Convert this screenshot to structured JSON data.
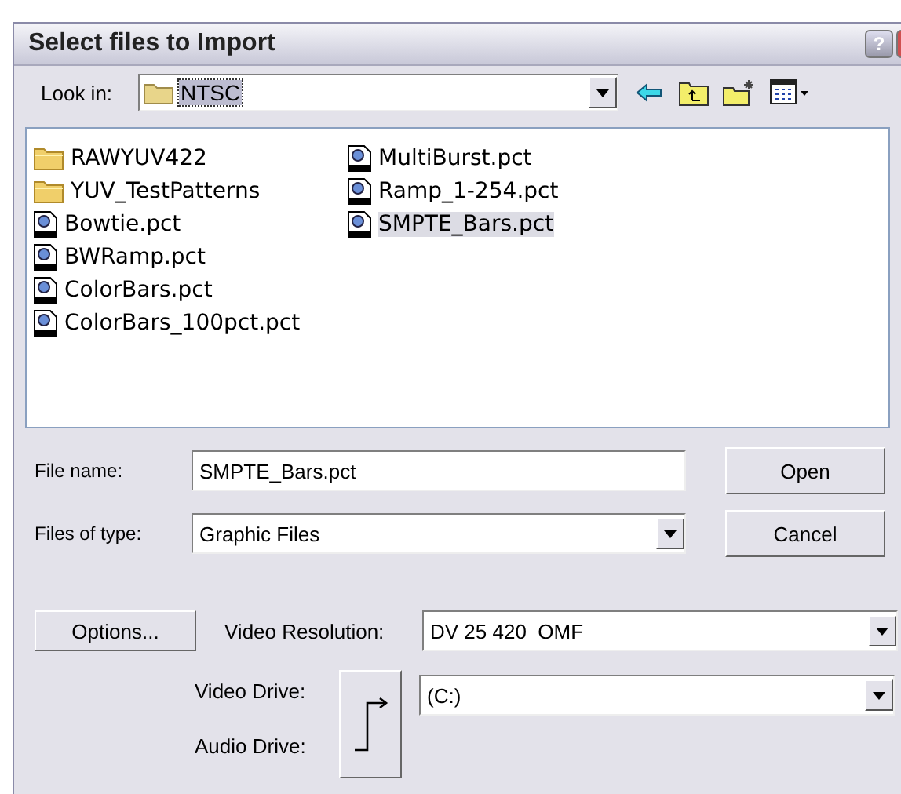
{
  "window": {
    "title": "Select files to Import",
    "help_button": "?"
  },
  "look_in": {
    "label": "Look in:",
    "value": "NTSC"
  },
  "files": [
    {
      "name": "RAWYUV422",
      "kind": "folder",
      "selected": false
    },
    {
      "name": "YUV_TestPatterns",
      "kind": "folder",
      "selected": false
    },
    {
      "name": "Bowtie.pct",
      "kind": "file",
      "selected": false
    },
    {
      "name": "BWRamp.pct",
      "kind": "file",
      "selected": false
    },
    {
      "name": "ColorBars.pct",
      "kind": "file",
      "selected": false
    },
    {
      "name": "ColorBars_100pct.pct",
      "kind": "file",
      "selected": false
    },
    {
      "name": "MultiBurst.pct",
      "kind": "file",
      "selected": false
    },
    {
      "name": "Ramp_1-254.pct",
      "kind": "file",
      "selected": false
    },
    {
      "name": "SMPTE_Bars.pct",
      "kind": "file",
      "selected": true
    }
  ],
  "file_name": {
    "label": "File name:",
    "value": "SMPTE_Bars.pct"
  },
  "file_type": {
    "label": "Files of type:",
    "value": "Graphic Files"
  },
  "buttons": {
    "open": "Open",
    "cancel": "Cancel",
    "options": "Options..."
  },
  "video_resolution": {
    "label": "Video Resolution:",
    "value": "DV 25 420  OMF"
  },
  "video_drive": {
    "label": "Video Drive:",
    "value": "(C:)"
  },
  "audio_drive": {
    "label": "Audio Drive:"
  }
}
